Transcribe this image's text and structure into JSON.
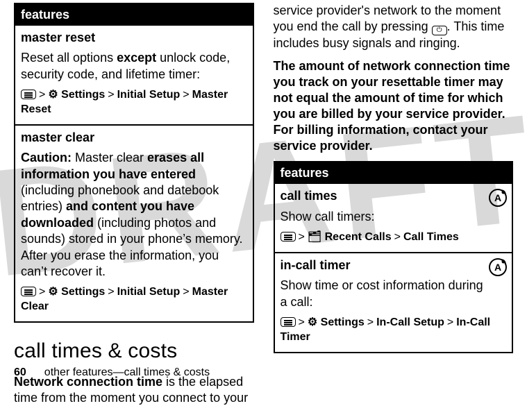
{
  "watermark": "DRAFT",
  "left_table": {
    "header": "features",
    "rows": [
      {
        "title": "master reset",
        "body_pre": "Reset all options ",
        "body_bold1": "except",
        "body_post": " unlock code, security code, and lifetime timer:",
        "nav": {
          "glyph": "⚙",
          "p1": "Settings",
          "p2": "Initial Setup",
          "p3": "Master Reset"
        }
      },
      {
        "title": "master clear",
        "caution_label": "Caution: ",
        "body_pre": "Master clear ",
        "body_bold1": "erases all information you have entered",
        "body_mid1": " (including phonebook and datebook entries) ",
        "body_bold2": "and content you have downloaded",
        "body_post": " (including photos and sounds) stored in your phone’s memory. After you erase the information, you can’t recover it.",
        "nav": {
          "glyph": "⚙",
          "p1": "Settings",
          "p2": "Initial Setup",
          "p3": "Master Clear"
        }
      }
    ]
  },
  "section_heading": "call times & costs",
  "left_para_pre": "Network connection time",
  "left_para_post": " is the elapsed time from the moment you connect to your",
  "right_para1_pre": "service provider's network to the moment you end the call by pressing ",
  "right_para1_post": ". This time includes busy signals and ringing.",
  "right_para2": "The amount of network connection time you track on your resettable timer may not equal the amount of time for which you are billed by your service provider. For billing information, contact your service provider.",
  "right_table": {
    "header": "features",
    "rows": [
      {
        "title": "call times",
        "body": "Show call timers:",
        "nav": {
          "glyph": "🗂",
          "p1": "Recent Calls",
          "p2": "Call Times"
        }
      },
      {
        "title": "in-call timer",
        "body": "Show time or cost information during a call:",
        "nav": {
          "glyph": "⚙",
          "p1": "Settings",
          "p2": "In-Call Setup",
          "p3": "In-Call Timer"
        }
      }
    ]
  },
  "footer": {
    "page": "60",
    "text": "other features—call times & costs"
  }
}
